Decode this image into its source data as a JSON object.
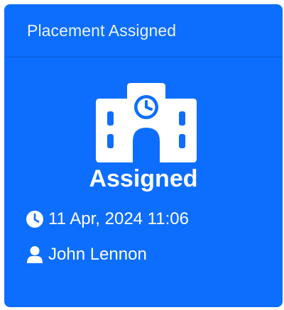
{
  "card": {
    "header_title": "Placement Assigned",
    "status": "Assigned",
    "status_icon": "school-icon",
    "date_icon": "clock-icon",
    "date": "11 Apr, 2024 11:06",
    "user_icon": "user-icon",
    "user": "John Lennon"
  },
  "colors": {
    "card_background": "#0d6efd",
    "text": "#ffffff"
  }
}
